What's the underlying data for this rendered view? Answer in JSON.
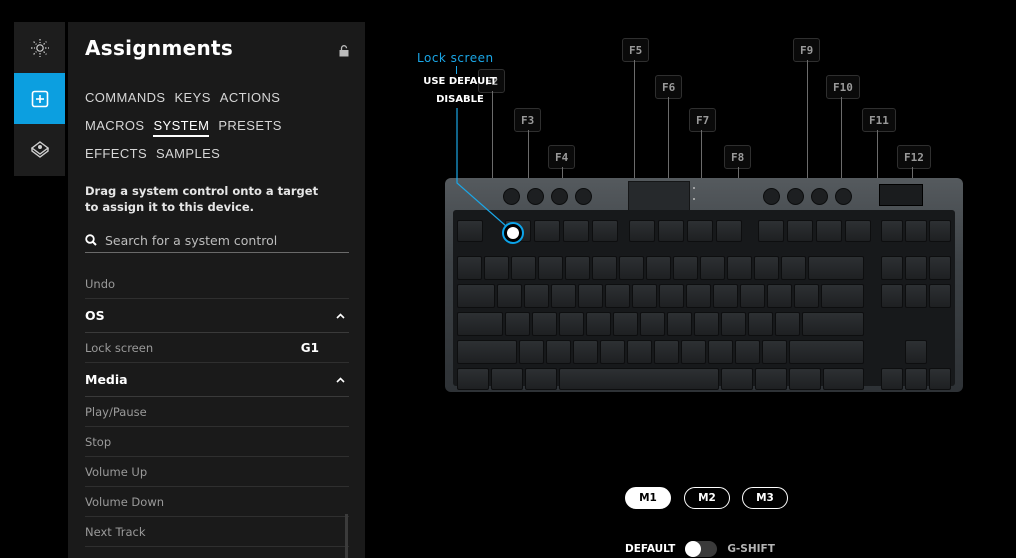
{
  "rail": {
    "items": [
      {
        "name": "lighting",
        "icon": "sun-icon",
        "active": false
      },
      {
        "name": "assignments",
        "icon": "plus-square-icon",
        "active": true
      },
      {
        "name": "game-mode",
        "icon": "joystick-icon",
        "active": false
      }
    ]
  },
  "panel": {
    "title": "Assignments",
    "categories_row1": [
      "COMMANDS",
      "KEYS",
      "ACTIONS"
    ],
    "categories_row2": [
      "MACROS",
      "SYSTEM",
      "PRESETS"
    ],
    "categories_row3": [
      "EFFECTS",
      "SAMPLES"
    ],
    "active_category": "SYSTEM",
    "hint": "Drag a system control onto a target to assign it to this device.",
    "search_placeholder": "Search for a system control",
    "list": {
      "undo": "Undo",
      "os_header": "OS",
      "lock_screen": "Lock screen",
      "lock_screen_tag": "G1",
      "media_header": "Media",
      "media_items": [
        "Play/Pause",
        "Stop",
        "Volume Up",
        "Volume Down",
        "Next Track"
      ]
    }
  },
  "keyboard": {
    "assigned_label": "Lock screen",
    "context_menu": [
      "USE DEFAULT",
      "DISABLE"
    ],
    "fkeys": [
      "F2",
      "F3",
      "F4",
      "F5",
      "F6",
      "F7",
      "F8",
      "F9",
      "F10",
      "F11",
      "F12"
    ]
  },
  "modes": {
    "buttons": [
      "M1",
      "M2",
      "M3"
    ],
    "active": "M1",
    "toggle_left": "DEFAULT",
    "toggle_right": "G-SHIFT"
  },
  "colors": {
    "accent": "#0c9fe0",
    "panel_bg": "#1a1a1a"
  }
}
